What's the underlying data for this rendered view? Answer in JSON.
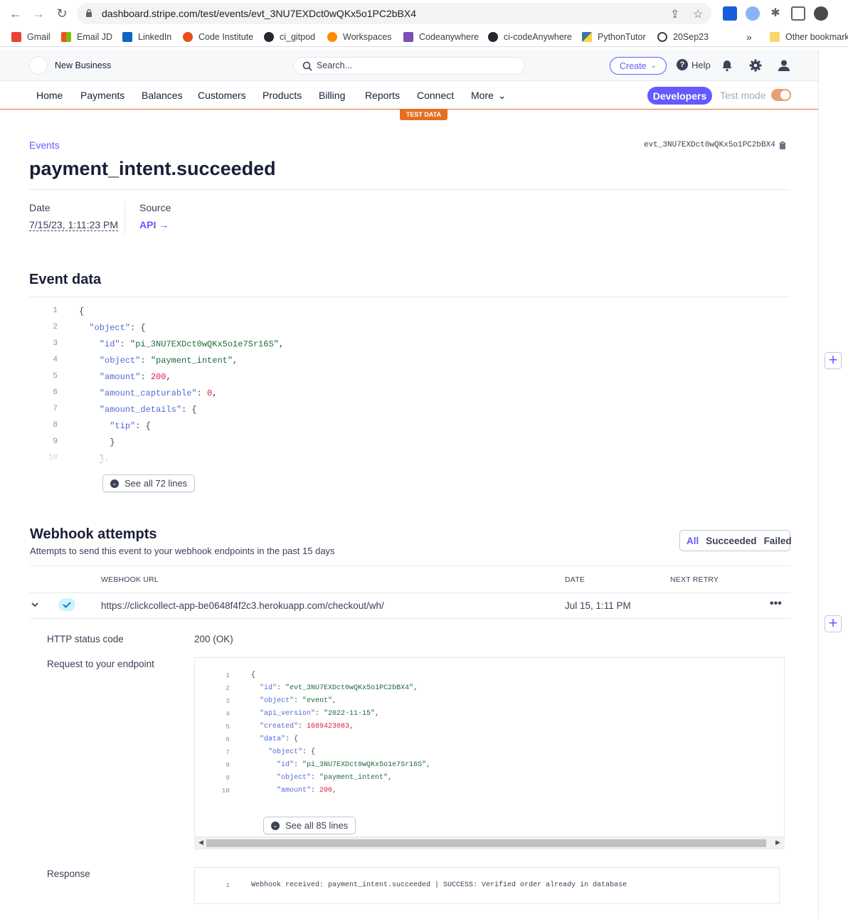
{
  "browser": {
    "url": "dashboard.stripe.com/test/events/evt_3NU7EXDct0wQKx5o1PC2bBX4",
    "bookmarks": [
      "Gmail",
      "Email JD",
      "LinkedIn",
      "Code Institute",
      "ci_gitpod",
      "Workspaces",
      "Codeanywhere",
      "ci-codeAnywhere",
      "PythonTutor",
      "20Sep23"
    ],
    "overflow": "»",
    "other_bookmarks": "Other bookmark"
  },
  "topbar": {
    "business": "New Business",
    "search_placeholder": "Search...",
    "create": "Create",
    "help": "Help"
  },
  "nav": {
    "items": [
      "Home",
      "Payments",
      "Balances",
      "Customers",
      "Products",
      "Billing",
      "Reports",
      "Connect",
      "More"
    ],
    "developers": "Developers",
    "test_mode": "Test mode",
    "test_mode_on": true,
    "test_badge": "TEST DATA"
  },
  "event": {
    "breadcrumb": "Events",
    "id": "evt_3NU7EXDct0wQKx5o1PC2bBX4",
    "title": "payment_intent.succeeded",
    "date_label": "Date",
    "date_value": "7/15/23, 1:11:23 PM",
    "source_label": "Source",
    "source_value": "API →"
  },
  "event_data": {
    "heading": "Event data",
    "see_all": "See all 72 lines",
    "lines": [
      {
        "n": "1",
        "t": [
          [
            "p",
            "{"
          ]
        ]
      },
      {
        "n": "2",
        "t": [
          [
            "p",
            "  "
          ],
          [
            "k",
            "\"object\""
          ],
          [
            "p",
            ": {"
          ]
        ]
      },
      {
        "n": "3",
        "t": [
          [
            "p",
            "    "
          ],
          [
            "k",
            "\"id\""
          ],
          [
            "p",
            ": "
          ],
          [
            "s",
            "\"pi_3NU7EXDct0wQKx5o1e7Sr16S\""
          ],
          [
            "p",
            ","
          ]
        ]
      },
      {
        "n": "4",
        "t": [
          [
            "p",
            "    "
          ],
          [
            "k",
            "\"object\""
          ],
          [
            "p",
            ": "
          ],
          [
            "s",
            "\"payment_intent\""
          ],
          [
            "p",
            ","
          ]
        ]
      },
      {
        "n": "5",
        "t": [
          [
            "p",
            "    "
          ],
          [
            "k",
            "\"amount\""
          ],
          [
            "p",
            ": "
          ],
          [
            "n",
            "200"
          ],
          [
            "p",
            ","
          ]
        ]
      },
      {
        "n": "6",
        "t": [
          [
            "p",
            "    "
          ],
          [
            "k",
            "\"amount_capturable\""
          ],
          [
            "p",
            ": "
          ],
          [
            "n",
            "0"
          ],
          [
            "p",
            ","
          ]
        ]
      },
      {
        "n": "7",
        "t": [
          [
            "p",
            "    "
          ],
          [
            "k",
            "\"amount_details\""
          ],
          [
            "p",
            ": {"
          ]
        ]
      },
      {
        "n": "8",
        "t": [
          [
            "p",
            "      "
          ],
          [
            "k",
            "\"tip\""
          ],
          [
            "p",
            ": {"
          ]
        ]
      },
      {
        "n": "9",
        "t": [
          [
            "p",
            "      }"
          ]
        ]
      },
      {
        "n": "10",
        "t": [
          [
            "p",
            "    },"
          ]
        ]
      }
    ]
  },
  "webhooks": {
    "heading": "Webhook attempts",
    "subtitle": "Attempts to send this event to your webhook endpoints in the past 15 days",
    "filters": [
      "All",
      "Succeeded",
      "Failed"
    ],
    "active_filter": "All",
    "columns": {
      "url": "WEBHOOK URL",
      "date": "DATE",
      "retry": "NEXT RETRY"
    },
    "row": {
      "url": "https://clickcollect-app-be0648f4f2c3.herokuapp.com/checkout/wh/",
      "date": "Jul 15, 1:11 PM",
      "next_retry": "",
      "more": "•••"
    },
    "status_label": "HTTP status code",
    "status_value": "200 (OK)",
    "request_label": "Request to your endpoint",
    "request_see_all": "See all 85 lines",
    "request_lines": [
      {
        "n": "1",
        "t": [
          [
            "p",
            "{"
          ]
        ]
      },
      {
        "n": "2",
        "t": [
          [
            "p",
            "  "
          ],
          [
            "k",
            "\"id\""
          ],
          [
            "p",
            ": "
          ],
          [
            "s",
            "\"evt_3NU7EXDct0wQKx5o1PC2bBX4\""
          ],
          [
            "p",
            ","
          ]
        ]
      },
      {
        "n": "3",
        "t": [
          [
            "p",
            "  "
          ],
          [
            "k",
            "\"object\""
          ],
          [
            "p",
            ": "
          ],
          [
            "s",
            "\"event\""
          ],
          [
            "p",
            ","
          ]
        ]
      },
      {
        "n": "4",
        "t": [
          [
            "p",
            "  "
          ],
          [
            "k",
            "\"api_version\""
          ],
          [
            "p",
            ": "
          ],
          [
            "s",
            "\"2022-11-15\""
          ],
          [
            "p",
            ","
          ]
        ]
      },
      {
        "n": "5",
        "t": [
          [
            "p",
            "  "
          ],
          [
            "k",
            "\"created\""
          ],
          [
            "p",
            ": "
          ],
          [
            "n",
            "1689423083"
          ],
          [
            "p",
            ","
          ]
        ]
      },
      {
        "n": "6",
        "t": [
          [
            "p",
            "  "
          ],
          [
            "k",
            "\"data\""
          ],
          [
            "p",
            ": {"
          ]
        ]
      },
      {
        "n": "7",
        "t": [
          [
            "p",
            "    "
          ],
          [
            "k",
            "\"object\""
          ],
          [
            "p",
            ": {"
          ]
        ]
      },
      {
        "n": "8",
        "t": [
          [
            "p",
            "      "
          ],
          [
            "k",
            "\"id\""
          ],
          [
            "p",
            ": "
          ],
          [
            "s",
            "\"pi_3NU7EXDct0wQKx5o1e7Sr16S\""
          ],
          [
            "p",
            ","
          ]
        ]
      },
      {
        "n": "9",
        "t": [
          [
            "p",
            "      "
          ],
          [
            "k",
            "\"object\""
          ],
          [
            "p",
            ": "
          ],
          [
            "s",
            "\"payment_intent\""
          ],
          [
            "p",
            ","
          ]
        ]
      },
      {
        "n": "10",
        "t": [
          [
            "p",
            "      "
          ],
          [
            "k",
            "\"amount\""
          ],
          [
            "p",
            ": "
          ],
          [
            "n",
            "200"
          ],
          [
            "p",
            ","
          ]
        ]
      }
    ],
    "response_label": "Response",
    "response_line_no": "1",
    "response_text": "Webhook received: payment_intent.succeeded | SUCCESS: Verified order already in database"
  },
  "colors": {
    "accent": "#635bff",
    "test": "#e56f1f"
  }
}
